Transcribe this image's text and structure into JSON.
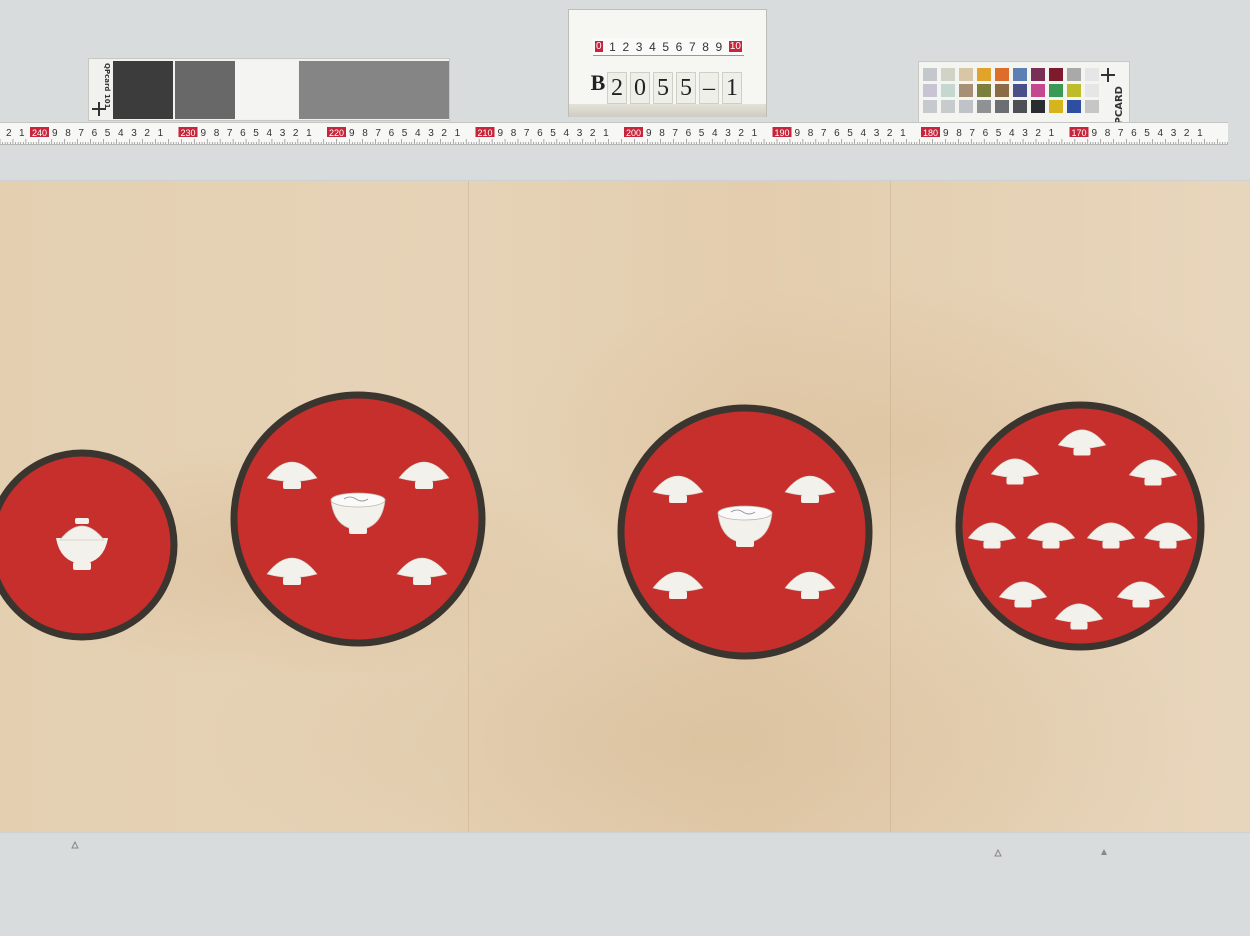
{
  "gray_card": {
    "brand": "QPcard 101",
    "patches": [
      "#3c3c3c",
      "#686868",
      "#f4f4f2",
      "#858585"
    ]
  },
  "label_card": {
    "mini_ruler": [
      "0",
      "1",
      "2",
      "3",
      "4",
      "5",
      "6",
      "7",
      "8",
      "9",
      "10"
    ],
    "accession_prefix": "B",
    "accession_chars": [
      "2",
      "0",
      "5",
      "5",
      "–",
      "1"
    ]
  },
  "color_card": {
    "brand": "QPCARD",
    "swatches": [
      "#c4c7cb",
      "#d0d3c6",
      "#d8c7a7",
      "#e1a32a",
      "#dd6d2b",
      "#5d7fb3",
      "#7a3055",
      "#7d1a2d",
      "#a9a9a9",
      "#e6e6e6",
      "#c9c4d4",
      "#c4d8d0",
      "#a78f76",
      "#7c7e3d",
      "#8a6b46",
      "#4a4f8a",
      "#c3488f",
      "#3a9a55",
      "#bdbd2a",
      "#e6e6e6",
      "#c6c9ce",
      "#c8cbce",
      "#bfc2c6",
      "#8f9295",
      "#6b6e72",
      "#4d5054",
      "#2a2c30",
      "#d6b41e",
      "#2e4fa0",
      "#c6c6c6"
    ]
  },
  "main_ruler": {
    "major_labels": [
      "240",
      "230",
      "220",
      "210",
      "200",
      "190",
      "180",
      "170"
    ],
    "digits": [
      "9",
      "8",
      "7",
      "6",
      "5",
      "4",
      "3",
      "2",
      "1"
    ],
    "lead": [
      "2",
      "1"
    ]
  },
  "scroll": {
    "plate_color": "#c62f2b",
    "rim_color": "#3b3530",
    "bowl_color": "#f3f1ec",
    "plates": [
      {
        "bowls_small": 0,
        "lidded_center": true
      },
      {
        "bowls_small": 4,
        "center_bowl": true
      },
      {
        "bowls_small": 4,
        "center_bowl": true
      },
      {
        "bowls_small": 10,
        "center_bowl": false
      }
    ]
  }
}
